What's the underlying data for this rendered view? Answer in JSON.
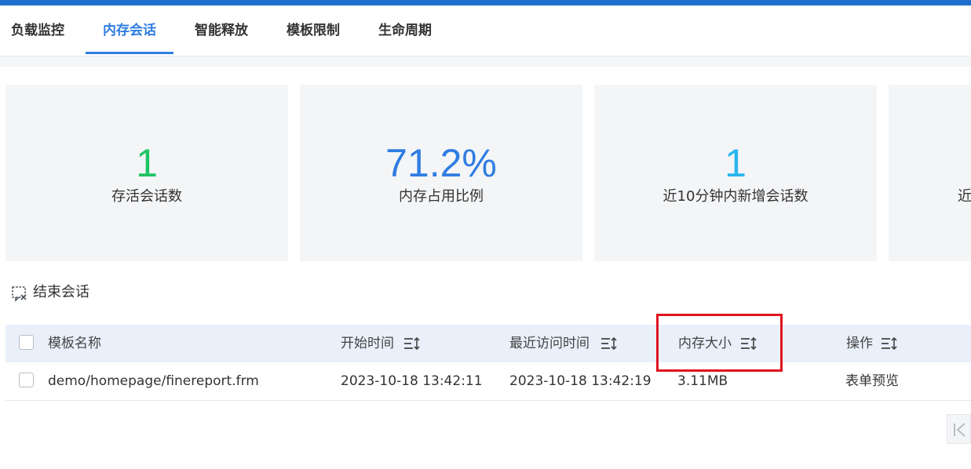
{
  "tabs": [
    {
      "label": "负载监控",
      "active": false
    },
    {
      "label": "内存会话",
      "active": true
    },
    {
      "label": "智能释放",
      "active": false
    },
    {
      "label": "模板限制",
      "active": false
    },
    {
      "label": "生命周期",
      "active": false
    }
  ],
  "stats": [
    {
      "value": "1",
      "caption": "存活会话数",
      "color": "#1ec463"
    },
    {
      "value": "71.2%",
      "caption": "内存占用比例",
      "color": "#2f7de1"
    },
    {
      "value": "1",
      "caption": "近10分钟内新增会话数",
      "color": "#27b6ee"
    },
    {
      "value": "",
      "caption": "近",
      "color": "#333333"
    }
  ],
  "toolbar": {
    "end_session_label": "结束会话",
    "end_session_icon": "end-session-icon"
  },
  "table": {
    "columns": [
      "模板名称",
      "开始时间",
      "最近访问时间",
      "内存大小",
      "操作"
    ],
    "rows": [
      {
        "name": "demo/homepage/finereport.frm",
        "start_time": "2023-10-18 13:42:11",
        "last_access": "2023-10-18 13:42:19",
        "memory": "3.11MB",
        "action": "表单预览"
      }
    ]
  },
  "colors": {
    "accent": "#2f7de1",
    "highlight_box": "#e0141e",
    "top_bar": "#1f6fcf"
  }
}
